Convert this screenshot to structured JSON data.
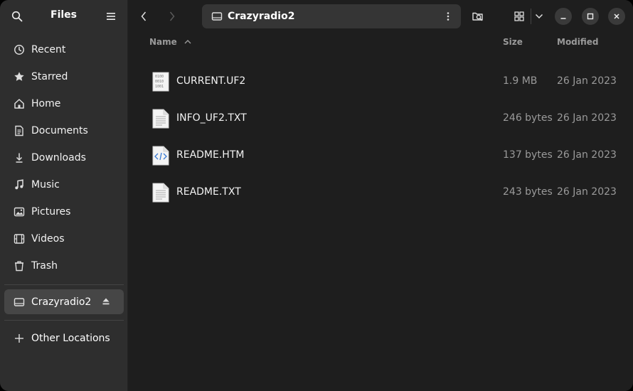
{
  "sidebar": {
    "title": "Files",
    "items": [
      {
        "label": "Recent",
        "icon": "clock-icon"
      },
      {
        "label": "Starred",
        "icon": "star-icon"
      },
      {
        "label": "Home",
        "icon": "home-icon"
      },
      {
        "label": "Documents",
        "icon": "document-icon"
      },
      {
        "label": "Downloads",
        "icon": "download-icon"
      },
      {
        "label": "Music",
        "icon": "music-icon"
      },
      {
        "label": "Pictures",
        "icon": "picture-icon"
      },
      {
        "label": "Videos",
        "icon": "video-icon"
      },
      {
        "label": "Trash",
        "icon": "trash-icon"
      }
    ],
    "device": {
      "label": "Crazyradio2"
    },
    "other": {
      "label": "Other Locations"
    }
  },
  "pathbar": {
    "location": "Crazyradio2"
  },
  "columns": {
    "name": "Name",
    "size": "Size",
    "modified": "Modified"
  },
  "files": [
    {
      "name": "CURRENT.UF2",
      "size": "1.9 MB",
      "modified": "26 Jan 2023",
      "icon": "binary-file-icon"
    },
    {
      "name": "INFO_UF2.TXT",
      "size": "246 bytes",
      "modified": "26 Jan 2023",
      "icon": "text-file-icon"
    },
    {
      "name": "README.HTM",
      "size": "137 bytes",
      "modified": "26 Jan 2023",
      "icon": "html-file-icon"
    },
    {
      "name": "README.TXT",
      "size": "243 bytes",
      "modified": "26 Jan 2023",
      "icon": "text-file-icon"
    }
  ]
}
